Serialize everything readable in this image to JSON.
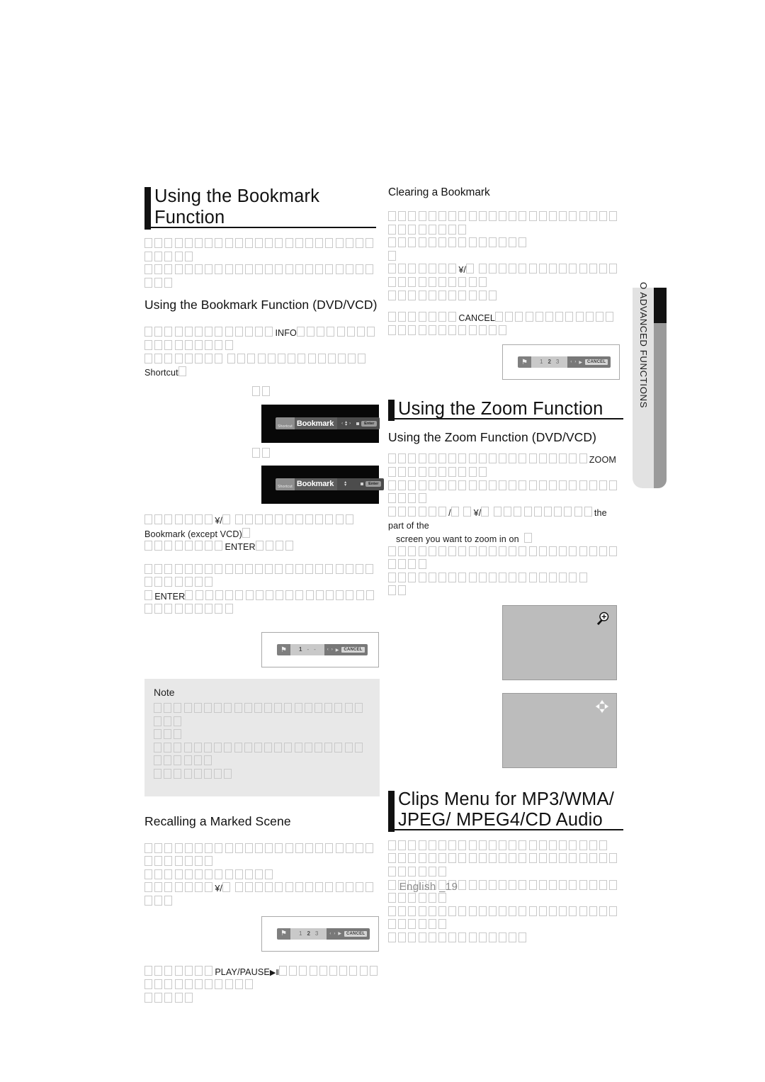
{
  "page": {
    "footer": "English _19",
    "side_tab": "O  ADVANCED FUNCTIONS"
  },
  "left_column": {
    "h1": "Using the Bookmark Function",
    "intro_tofu_lines": [
      28,
      26
    ],
    "h2_bookmark": "Using the Bookmark Function (DVD/VCD)",
    "step1": {
      "pre_tofu": 13,
      "lit1": "INFO",
      "mid_tofu": 17,
      "tofu_line2_a": 8,
      "tofu_line2_b": 14,
      "lit2": "Shortcut",
      "post_tofu": 1
    },
    "caption_a": 2,
    "caption_b": 2,
    "osd_1": {
      "shortcut": "Shortcut",
      "title": "Bookmark",
      "enter": "Enter",
      "left_arrow": "‹",
      "right_arrow": "›",
      "up_arrow": "▴",
      "down_arrow": "▾"
    },
    "osd_2": {
      "shortcut": "Shortcut",
      "title": "Bookmark",
      "enter": "Enter",
      "up_arrow": "▴",
      "down_arrow": "▾"
    },
    "step2": {
      "pre_tofu": 7,
      "lit_arrow": "¥/",
      "mid_tofu": 12,
      "lit_bookmark": "Bookmark (except VCD)",
      "tail_tofu": 1,
      "line2_pre": 8,
      "lit_enter": "ENTER",
      "line2_tail": 4
    },
    "step3": {
      "line1_tofu": 30,
      "line2_pre": 1,
      "lit_enter": "ENTER",
      "line2_tofu": 28
    },
    "bookmark_shot_1": {
      "numbers": [
        "1",
        "-",
        "-"
      ],
      "active_index": 0,
      "cancel": "CANCEL",
      "left_arrow": "‹",
      "right_arrow": "›",
      "play_icon": "▶"
    },
    "note": {
      "title": "Note",
      "line1_tofu": 24,
      "line2_tofu": 3,
      "line3_tofu": 27,
      "line4_tofu": 8
    },
    "h2_recalling": "Recalling a Marked Scene",
    "recall": {
      "line1_tofu": 30,
      "line2_tofu": 13,
      "line3_pre": 7,
      "lit_arrow": "¥/",
      "line3_tofu": 17
    },
    "bookmark_shot_2": {
      "numbers": [
        "1",
        "2",
        "3"
      ],
      "active_index": 1,
      "cancel": "CANCEL",
      "left_arrow": "‹",
      "right_arrow": "›",
      "play_icon": "▶"
    },
    "play_step": {
      "pre_tofu": 7,
      "lit_play": "PLAY/PAUSE",
      "icon": "▶‖",
      "post_tofu": 21,
      "line2_tofu": 5
    }
  },
  "right_column": {
    "h3_clearing": "Clearing a Bookmark",
    "clearing": {
      "line1_tofu": 31,
      "line2_tofu": 14,
      "line3_tofu": 1,
      "line4_pre": 7,
      "lit_arrow": "¥/",
      "line4_tofu": 24,
      "line5_tofu": 11,
      "line6_pre": 7,
      "lit_cancel": "CANCEL",
      "line6_tofu": 24
    },
    "bookmark_shot_3": {
      "numbers": [
        "1",
        "2",
        "3"
      ],
      "active_index": 1,
      "cancel": "CANCEL",
      "left_arrow": "‹",
      "right_arrow": "›",
      "play_icon": "▶"
    },
    "h1_zoom": "Using the Zoom Function",
    "h2_zoom": "Using the Zoom Function (DVD/VCD)",
    "zoom_body": {
      "line1_pre": 20,
      "lit_zoom": "ZOOM",
      "line1_post": 10,
      "line2_tofu": 27,
      "line3_pre": 6,
      "lit_slash": "/",
      "line3_mid1": 2,
      "lit_arrow": "¥/",
      "line3_mid2": 10,
      "lit_part": "the part of the",
      "lit_screen": "screen you want to zoom in on",
      "line4_tofu_end": 1,
      "line5_tofu": 27,
      "line6_tofu": 20,
      "line7_tofu": 2
    },
    "zoom_panel_1_icon": "magnifier-plus",
    "zoom_panel_2_icon": "four-direction-arrows",
    "h1_clips": "Clips Menu for MP3/WMA/ JPEG/ MPEG4/CD Audio",
    "clips_body": {
      "line1_tofu": 22,
      "line2_tofu": 29,
      "line3_tofu": 29,
      "line4_tofu": 29,
      "line5_tofu": 14
    }
  }
}
